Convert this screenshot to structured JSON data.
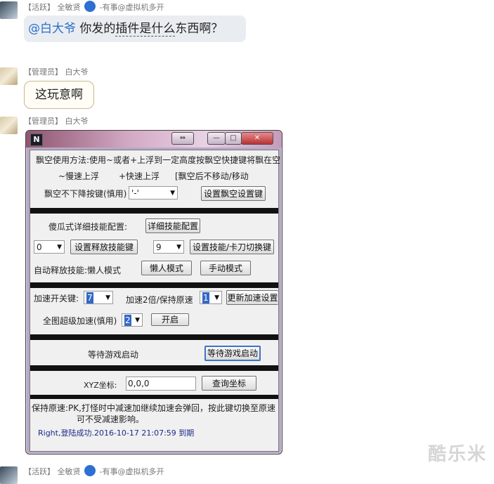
{
  "chat": {
    "msg1": {
      "tag": "【活跃】",
      "name": "全敏贤",
      "after": "-有事@虚拟机多开",
      "mention": "@白大爷",
      "text": " 你发的",
      "text_u": "插件是什么",
      "text_tail": "东西啊？"
    },
    "msg2": {
      "tag": "【管理员】",
      "name": "白大爷",
      "text": "这玩意啊"
    },
    "msg3": {
      "tag": "【管理员】",
      "name": "白大爷"
    },
    "msg4": {
      "tag": "【活跃】",
      "name": "全敏贤",
      "after": "-有事@虚拟机多开"
    }
  },
  "window": {
    "app_icon": "N",
    "restore_glyph": "⇔",
    "min_glyph": "—",
    "max_glyph": "□",
    "close_glyph": "✕",
    "float": {
      "usage": "飘空使用方法:使用~或者+上浮到一定高度按飘空快捷键将飘在空",
      "slow_up": "~慢速上浮",
      "fast_up": "+快速上浮",
      "after_float": "[飘空后不移动/移动",
      "hotkey_label": "飘空不下降按键(慎用)",
      "hotkey_value": "'-'",
      "set_btn": "设置飘空设置键"
    },
    "skills": {
      "title": "傻瓜式详细技能配置:",
      "detail_btn": "详细技能配置",
      "combo_a": "0",
      "set_release_btn": "设置释放技能键",
      "combo_b": "9",
      "set_switch_btn": "设置技能/卡刀切换键",
      "auto_label": "自动释放技能:懒人模式",
      "lazy_btn": "懒人模式",
      "manual_btn": "手动模式"
    },
    "speed": {
      "switch_label": "加速开关键:",
      "switch_value": "7",
      "double_label": "加速2倍/保持原速",
      "double_value": "1",
      "update_btn": "更新加速设置",
      "global_label": "全图超级加速(慎用)",
      "global_value": "2",
      "start_btn": "开启"
    },
    "game": {
      "label": "等待游戏启动",
      "btn": "等待游戏启动"
    },
    "coord": {
      "label": "XYZ坐标:",
      "value": "0,0,0",
      "btn": "查询坐标"
    },
    "notes": {
      "line1": "保持原速:PK,打怪时中减速加继续加速会弹回，按此键切换至原速",
      "line2": "可不受减速影响。",
      "status": "Right,登陆成功.2016-10-17 21:07:59 到期"
    }
  },
  "watermark": "酷乐米",
  "colors": {
    "accent": "#3368c5",
    "bubble": "#e9edf2",
    "frame": "#b7a9c8"
  }
}
